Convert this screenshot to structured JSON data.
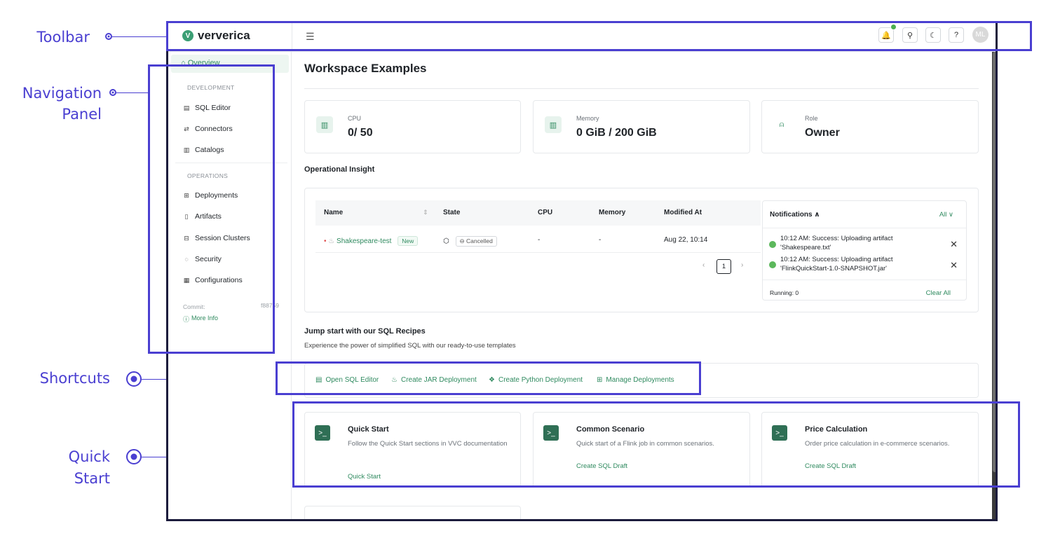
{
  "annotations": {
    "toolbar": "Toolbar",
    "navigation_line1": "Navigation",
    "navigation_line2": "Panel",
    "shortcuts": "Shortcuts",
    "quick_line1": "Quick",
    "quick_line2": "Start",
    "color": "#4a3fd1"
  },
  "toolbar": {
    "logo": "ververica",
    "collapse_icon": "menu-collapse-icon",
    "icons": [
      "bell-icon",
      "link-icon",
      "moon-icon",
      "help-icon"
    ],
    "avatar": "ML"
  },
  "sidebar": {
    "overview": "Overview",
    "dev_heading": "DEVELOPMENT",
    "dev_items": [
      {
        "label": "SQL Editor",
        "icon": "sql-editor-icon"
      },
      {
        "label": "Connectors",
        "icon": "connector-icon"
      },
      {
        "label": "Catalogs",
        "icon": "catalog-icon"
      }
    ],
    "ops_heading": "OPERATIONS",
    "ops_items": [
      {
        "label": "Deployments",
        "icon": "deployment-icon"
      },
      {
        "label": "Artifacts",
        "icon": "artifact-icon"
      },
      {
        "label": "Session Clusters",
        "icon": "cluster-icon"
      },
      {
        "label": "Security",
        "icon": "shield-icon"
      },
      {
        "label": "Configurations",
        "icon": "config-icon"
      }
    ],
    "commit_label": "Commit:",
    "commit_hash": "f88759",
    "more_info": "More Info"
  },
  "main": {
    "title": "Workspace Examples",
    "stats": [
      {
        "label": "CPU",
        "value": "0/ 50"
      },
      {
        "label": "Memory",
        "value": "0 GiB / 200 GiB"
      },
      {
        "label": "Role",
        "value": "Owner"
      }
    ],
    "insight_title": "Operational Insight",
    "table": {
      "headers": [
        "Name",
        "State",
        "CPU",
        "Memory",
        "Modified At"
      ],
      "row": {
        "name": "Shakespeare-test",
        "tag": "New",
        "state": "Cancelled",
        "cpu": "-",
        "memory": "-",
        "modified": "Aug 22, 10:14"
      },
      "page": "1"
    },
    "notifications": {
      "title": "Notifications",
      "filter": "All",
      "items": [
        {
          "line1": "10:12 AM: Success: Uploading artifact",
          "line2": "'Shakespeare.txt'"
        },
        {
          "line1": "10:12 AM: Success: Uploading artifact",
          "line2": "'FlinkQuickStart-1.0-SNAPSHOT.jar'"
        }
      ],
      "running": "Running: 0",
      "clear_all": "Clear All"
    },
    "recipes_title": "Jump start with our SQL Recipes",
    "recipes_sub": "Experience the power of simplified SQL with our ready-to-use templates",
    "shortcuts": [
      {
        "label": "Open SQL Editor",
        "icon": "sql-editor-icon"
      },
      {
        "label": "Create JAR Deployment",
        "icon": "java-icon"
      },
      {
        "label": "Create Python Deployment",
        "icon": "python-icon"
      },
      {
        "label": "Manage Deployments",
        "icon": "deployment-icon"
      }
    ],
    "quick_cards": [
      {
        "title": "Quick Start",
        "desc": "Follow the Quick Start sections in VVC documentation",
        "link": "Quick Start"
      },
      {
        "title": "Common Scenario",
        "desc": "Quick start of a Flink job in common scenarios.",
        "link": "Create SQL Draft"
      },
      {
        "title": "Price Calculation",
        "desc": "Order price calculation in e-commerce scenarios.",
        "link": "Create SQL Draft"
      }
    ]
  }
}
